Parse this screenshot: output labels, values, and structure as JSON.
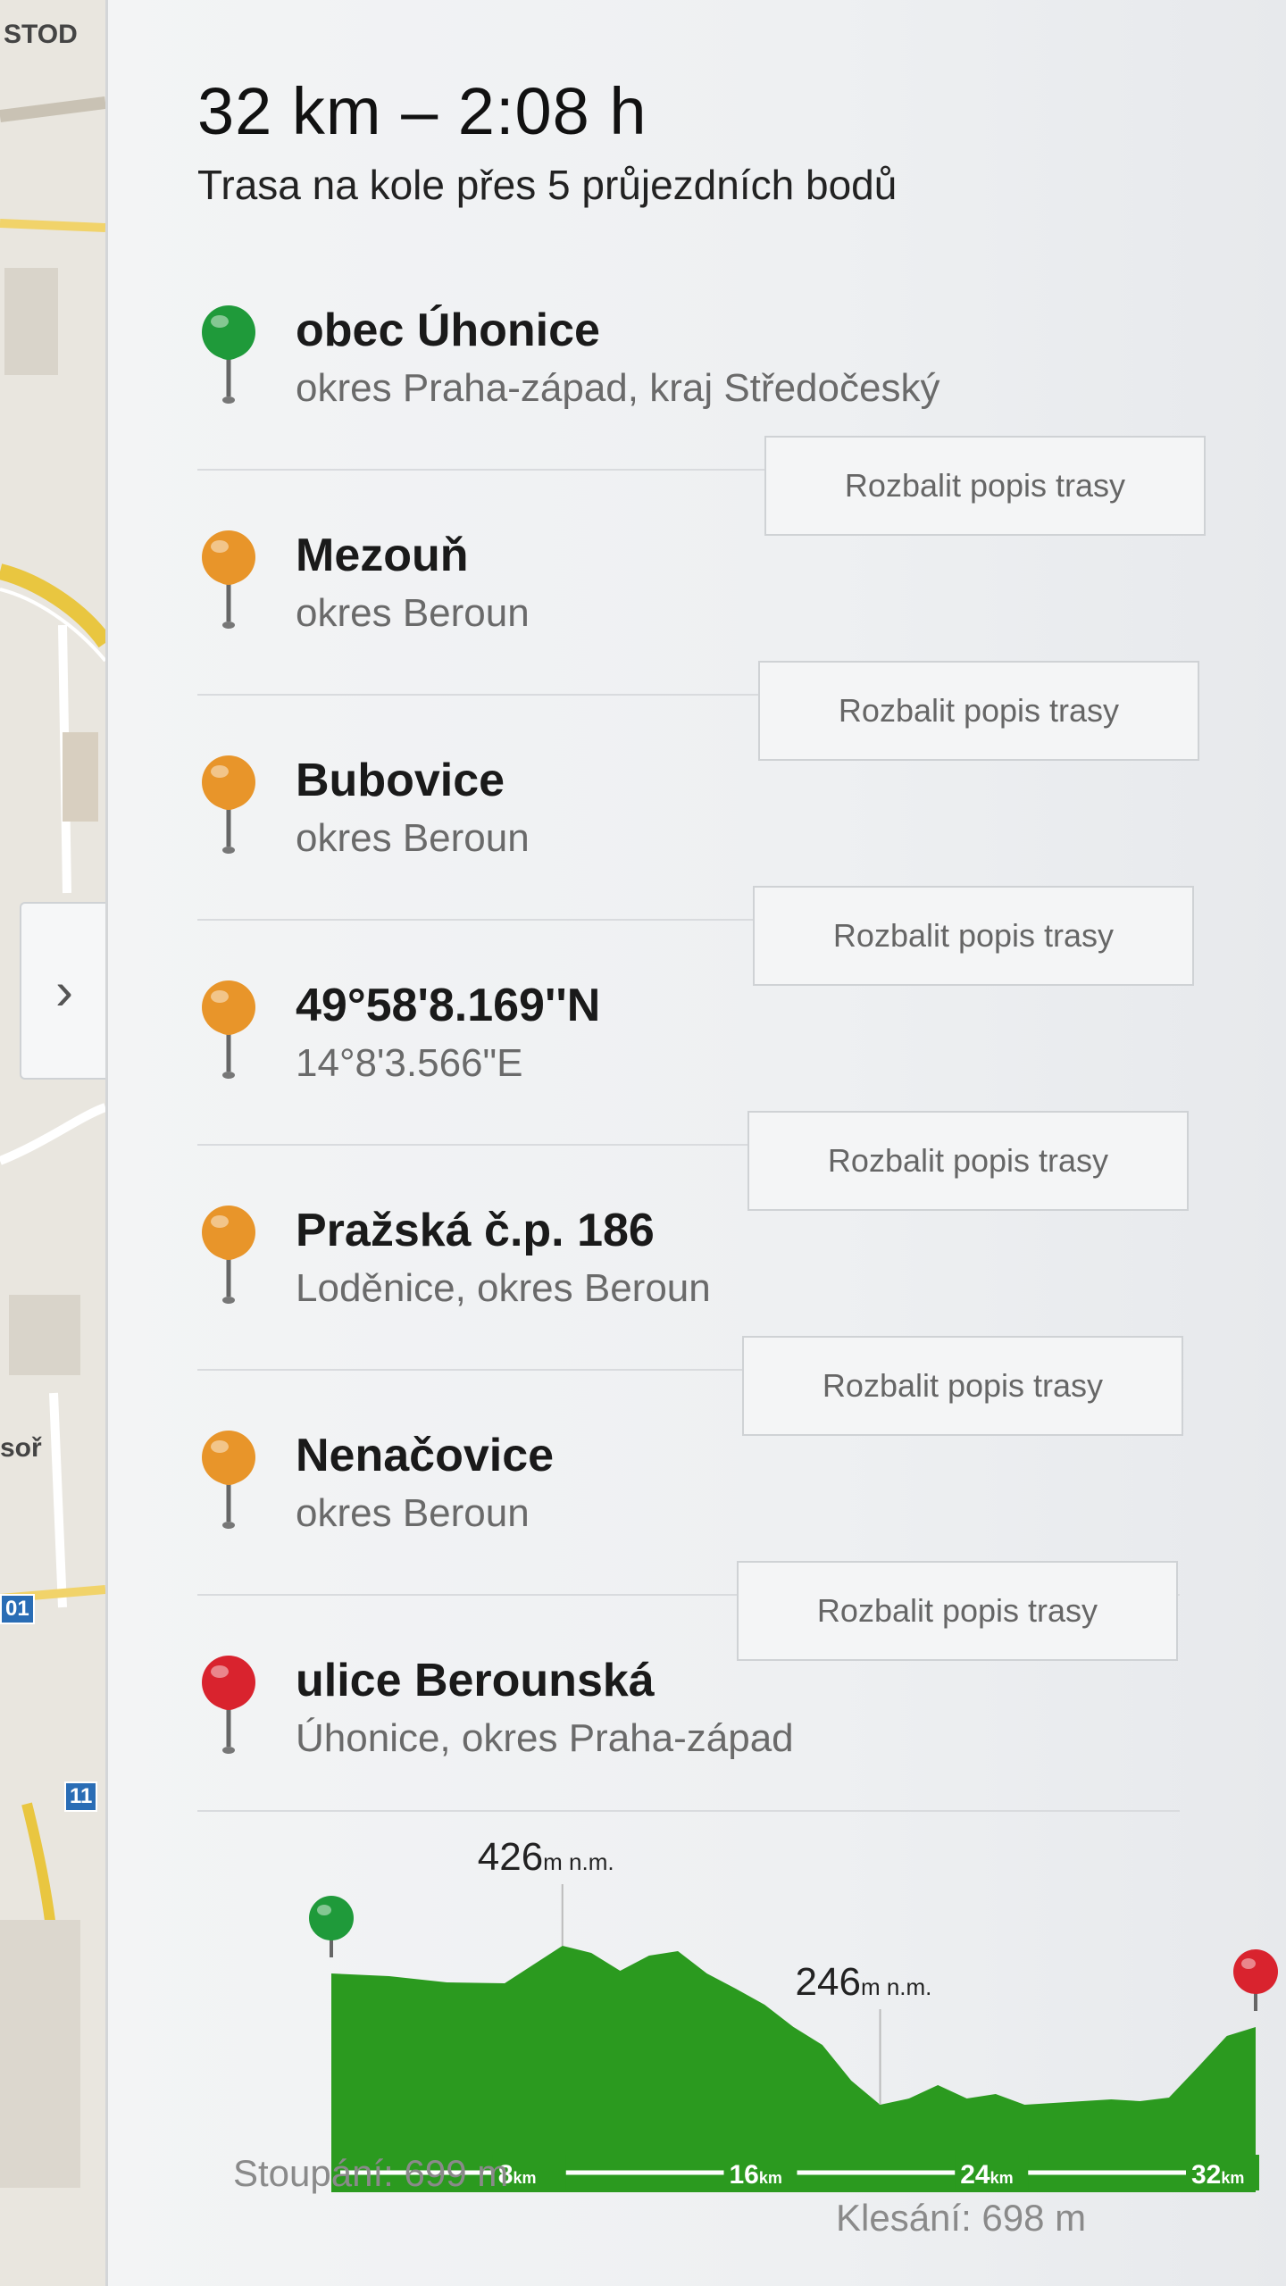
{
  "map": {
    "labels": [
      "STOD",
      "soř"
    ],
    "road_signs": [
      "01",
      "11"
    ],
    "collapse_icon": "chevron-right-icon"
  },
  "summary": {
    "title": "32 km – 2:08 h",
    "subtitle": "Trasa na kole přes 5 průjezdních bodů"
  },
  "waypoints": [
    {
      "name": "obec Úhonice",
      "sub": "okres Praha-západ, kraj Středočeský",
      "pin": "green-pin-icon",
      "color": "#1f9a3a"
    },
    {
      "name": "Mezouň",
      "sub": "okres Beroun",
      "pin": "orange-pin-icon",
      "color": "#e8952a"
    },
    {
      "name": "Bubovice",
      "sub": "okres Beroun",
      "pin": "orange-pin-icon",
      "color": "#e8952a"
    },
    {
      "name": "49°58'8.169''N",
      "sub": "14°8'3.566\"E",
      "pin": "orange-pin-icon",
      "color": "#e8952a"
    },
    {
      "name": "Pražská č.p. 186",
      "sub": "Loděnice, okres Beroun",
      "pin": "orange-pin-icon",
      "color": "#e8952a"
    },
    {
      "name": "Nenačovice",
      "sub": "okres Beroun",
      "pin": "orange-pin-icon",
      "color": "#e8952a"
    },
    {
      "name": "ulice Berounská",
      "sub": "Úhonice, okres Praha-západ",
      "pin": "red-pin-icon",
      "color": "#d9232e"
    }
  ],
  "expand_button_label": "Rozbalit popis trasy",
  "elevation": {
    "max_value": "426",
    "min_value": "246",
    "unit": "m n.m.",
    "distance_ticks": [
      "8",
      "16",
      "24",
      "32"
    ],
    "distance_unit": "km",
    "climb": "Stoupání: 699 m",
    "descent": "Klesání: 698 m",
    "fill_color": "#2b9a1f",
    "profile_km": [
      0,
      2,
      4,
      6,
      8,
      9,
      10,
      11,
      12,
      13,
      14,
      15,
      16,
      17,
      18,
      19,
      20,
      21,
      22,
      23,
      24,
      25,
      26,
      27,
      28,
      29,
      30,
      31,
      32
    ],
    "profile_m": [
      395,
      392,
      385,
      384,
      426,
      418,
      398,
      415,
      420,
      395,
      378,
      360,
      335,
      315,
      275,
      248,
      255,
      270,
      255,
      260,
      248,
      250,
      252,
      254,
      252,
      256,
      290,
      325,
      335
    ]
  }
}
